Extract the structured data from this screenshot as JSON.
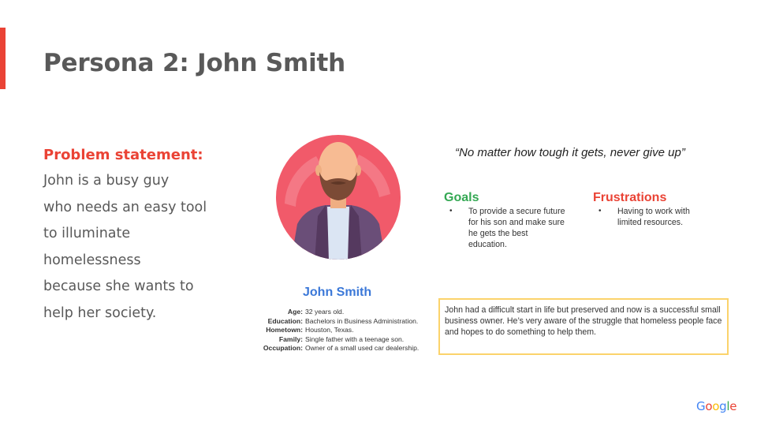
{
  "slide": {
    "title_prefix": "Persona 2: ",
    "title_name": "John Smith"
  },
  "problem": {
    "heading": "Problem statement:",
    "lines": [
      "John is a busy guy",
      "who needs an easy tool",
      "to illuminate",
      "homelessness",
      "because she wants to",
      "help her society."
    ]
  },
  "persona": {
    "name": "John Smith",
    "details": [
      {
        "label": "Age:",
        "value": "32 years old."
      },
      {
        "label": "Education:",
        "value": "Bachelors in Business Administration."
      },
      {
        "label": "Hometown:",
        "value": "Houston, Texas."
      },
      {
        "label": "Family:",
        "value": "Single father with a teenage son."
      },
      {
        "label": "Occupation:",
        "value": "Owner of a small used car dealership."
      }
    ]
  },
  "quote": "“No matter how tough it gets, never give up”",
  "goals": {
    "heading": "Goals",
    "items": [
      "To provide a secure future for his son and make sure he gets the best education."
    ]
  },
  "frustrations": {
    "heading": "Frustrations",
    "items": [
      "Having to work with limited resources."
    ]
  },
  "bio": "John had a difficult start in life but preserved and now is a successful small business owner. He’s very aware of the struggle that homeless people face and hopes to do something to help them.",
  "branding": {
    "logo_letters": [
      {
        "char": "G",
        "color": "#4285f4"
      },
      {
        "char": "o",
        "color": "#ea4335"
      },
      {
        "char": "o",
        "color": "#fbbc05"
      },
      {
        "char": "g",
        "color": "#4285f4"
      },
      {
        "char": "l",
        "color": "#34a853"
      },
      {
        "char": "e",
        "color": "#ea4335"
      }
    ]
  },
  "colors": {
    "accent": "#ea4335",
    "goals": "#34a853",
    "name": "#3b78d8",
    "bio_border": "#fbd36b"
  }
}
